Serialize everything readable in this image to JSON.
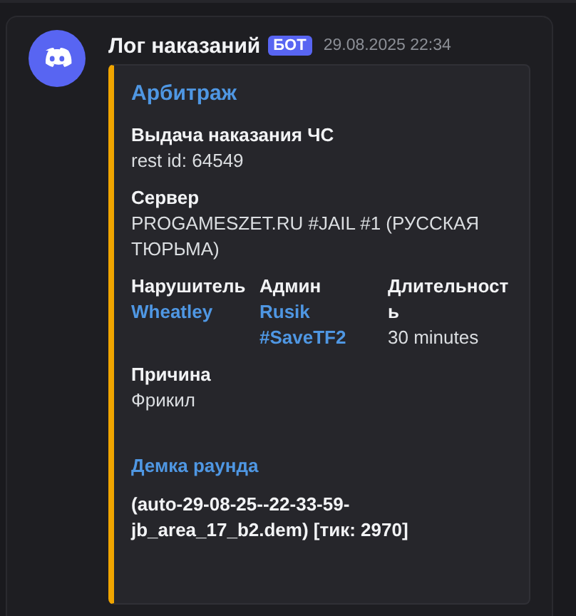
{
  "message": {
    "author": "Лог наказаний",
    "badge": "БОТ",
    "timestamp": "29.08.2025 22:34"
  },
  "embed": {
    "title": "Арбитраж",
    "fields": [
      {
        "name": "Выдача наказания ЧС",
        "value": "rest id: 64549",
        "inline": false,
        "kind": "text"
      },
      {
        "name": "Сервер",
        "value": "PROGAMESZET.RU #JAIL #1 (РУССКАЯ ТЮРЬМА)",
        "inline": false,
        "kind": "text"
      },
      {
        "name": "Нарушитель",
        "value": "Wheatley",
        "inline": true,
        "kind": "link"
      },
      {
        "name": "Админ",
        "value": "Rusik #SaveTF2",
        "inline": true,
        "kind": "link"
      },
      {
        "name": "Длительность",
        "value": "30 minutes",
        "inline": true,
        "kind": "text"
      },
      {
        "name": "Причина",
        "value": "Фрикил",
        "inline": false,
        "kind": "text"
      }
    ],
    "demo": {
      "title": "Демка раунда",
      "text": "(auto-29-08-25--22-33-59-jb_area_17_b2.dem) [тик: 2970]"
    }
  }
}
